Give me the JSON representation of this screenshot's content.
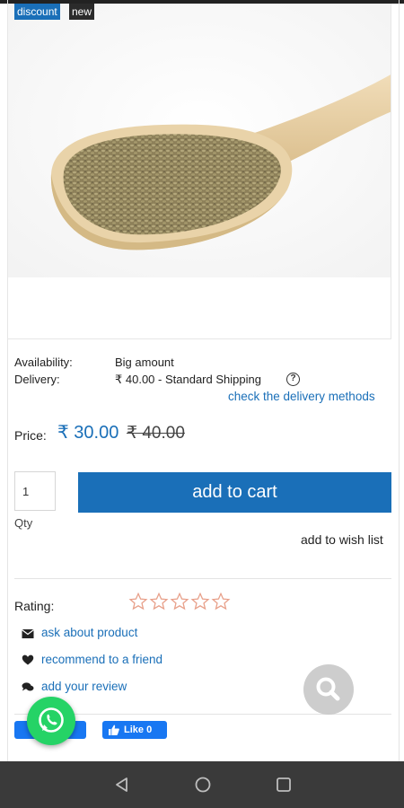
{
  "badges": {
    "discount": "discount",
    "new": "new"
  },
  "product": {
    "availability_label": "Availability:",
    "availability_value": "Big amount",
    "delivery_label": "Delivery:",
    "delivery_value": "₹ 40.00 - Standard Shipping",
    "delivery_link": "check the delivery methods",
    "price_label": "Price:",
    "price_new": "₹ 30.00",
    "price_old": "₹ 40.00"
  },
  "cart": {
    "qty_value": "1",
    "qty_label": "Qty",
    "add_to_cart": "add to cart",
    "wishlist": "add to wish list"
  },
  "rating": {
    "label": "Rating:",
    "stars_filled": 0,
    "stars_total": 5,
    "star_color": "#e8a08a"
  },
  "actions": [
    {
      "label": "ask about product",
      "icon": "envelope-icon"
    },
    {
      "label": "recommend to a friend",
      "icon": "heart-icon"
    },
    {
      "label": "add your review",
      "icon": "comments-icon"
    }
  ],
  "social": {
    "like_label": "Like 0"
  },
  "colors": {
    "accent": "#1a6fb8",
    "whatsapp": "#25d366",
    "facebook": "#1877f2"
  }
}
